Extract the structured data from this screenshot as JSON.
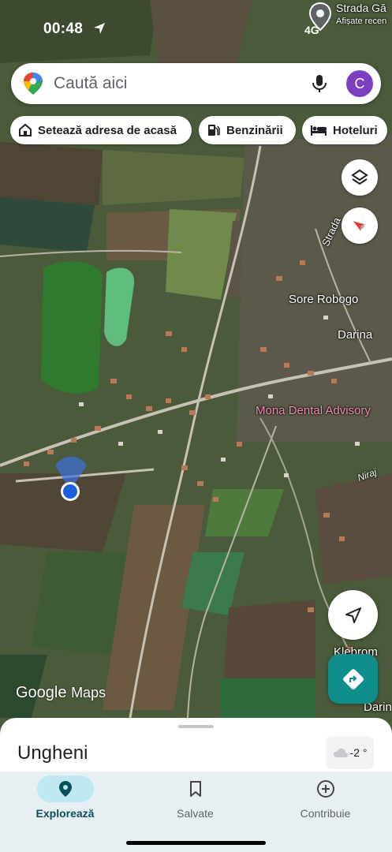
{
  "status": {
    "time": "00:48",
    "network": "4G"
  },
  "search": {
    "placeholder": "Caută aici",
    "avatar_letter": "C"
  },
  "chips": {
    "home": "Setează adresa de acasă",
    "gas": "Benzinării",
    "hotels": "Hoteluri"
  },
  "map_labels": {
    "top_right_street": "Strada Gă",
    "top_right_sub": "Afișate recen",
    "street_vertical": "Strada",
    "place_1": "Sore Robogo",
    "place_2": "Darina",
    "place_3": "Mona Dental Advisory",
    "river": "Niraj",
    "place_4": "Klebrom",
    "place_5": "Darin"
  },
  "logo": {
    "google": "Google",
    "maps": "Maps"
  },
  "sheet": {
    "place_name": "Ungheni",
    "weather": "-2 °"
  },
  "nav": {
    "explore": "Explorează",
    "saved": "Salvate",
    "contribute": "Contribuie"
  },
  "colors": {
    "accent_teal": "#0f8c8c",
    "avatar": "#7b3fbf",
    "location_dot": "#1a5fe0",
    "nav_active_pill": "#bfe8f0"
  }
}
